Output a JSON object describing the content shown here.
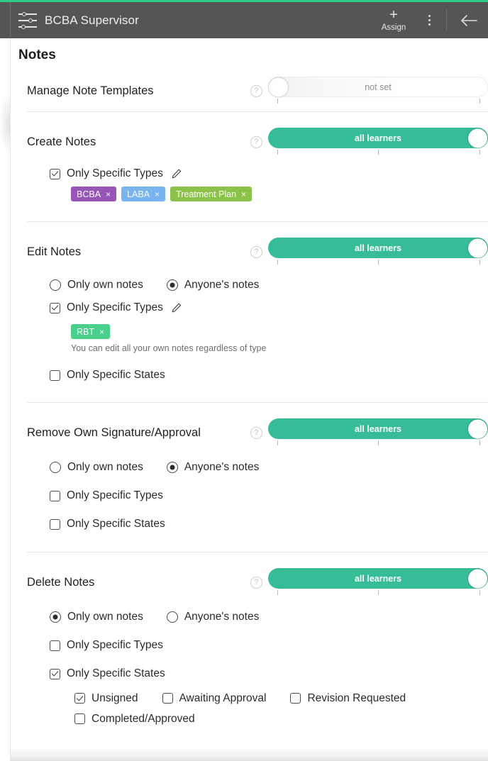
{
  "header": {
    "menu_icon": "sliders-icon",
    "title": "BCBA Supervisor",
    "assign_plus": "+",
    "assign_label": "Assign",
    "overflow_icon": "kebab-menu-icon",
    "back_icon": "back-arrow-icon",
    "accent_color": "#2ec98f",
    "background_color": "#555555"
  },
  "page": {
    "title": "Notes"
  },
  "labels": {
    "help": "?",
    "only_own_notes": "Only own notes",
    "anyones_notes": "Anyone's notes",
    "only_specific_types": "Only Specific Types",
    "only_specific_states": "Only Specific States",
    "edit_icon": "pencil-icon",
    "chip_remove": "×"
  },
  "sections": [
    {
      "id": "manage-note-templates",
      "title": "Manage Note Templates",
      "slider": {
        "value": "not set",
        "state": "off",
        "ticks": 2
      },
      "options": []
    },
    {
      "id": "create-notes",
      "title": "Create Notes",
      "slider": {
        "value": "all learners",
        "state": "on",
        "ticks": 3
      },
      "types_checked": true,
      "chips": [
        {
          "label": "BCBA",
          "color": "#9755b8"
        },
        {
          "label": "LABA",
          "color": "#79b4ef"
        },
        {
          "label": "Treatment Plan",
          "color": "#8bc34a"
        }
      ]
    },
    {
      "id": "edit-notes",
      "title": "Edit Notes",
      "slider": {
        "value": "all learners",
        "state": "on",
        "ticks": 3
      },
      "scope": "anyone",
      "types_checked": true,
      "chips": [
        {
          "label": "RBT",
          "color": "#4ad08c"
        }
      ],
      "helper": "You can edit all your own notes regardless of type",
      "states_checked": false
    },
    {
      "id": "remove-own-signature",
      "title": "Remove Own Signature/Approval",
      "slider": {
        "value": "all learners",
        "state": "on",
        "ticks": 3
      },
      "scope": "anyone",
      "types_checked": false,
      "states_checked": false
    },
    {
      "id": "delete-notes",
      "title": "Delete Notes",
      "slider": {
        "value": "all learners",
        "state": "on",
        "ticks": 3
      },
      "scope": "own",
      "types_checked": false,
      "states_checked": true,
      "states": [
        {
          "label": "Unsigned",
          "checked": true
        },
        {
          "label": "Awaiting Approval",
          "checked": false
        },
        {
          "label": "Revision Requested",
          "checked": false
        },
        {
          "label": "Completed/Approved",
          "checked": false
        }
      ]
    }
  ]
}
